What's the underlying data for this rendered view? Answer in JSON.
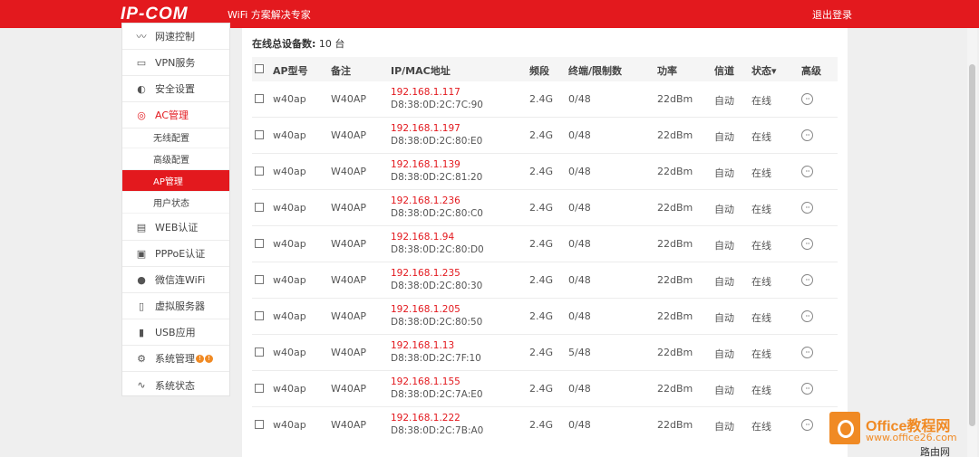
{
  "header": {
    "logo": "IP-COM",
    "slogan": "WiFi 方案解决专家",
    "logout": "退出登录"
  },
  "sidebar": {
    "items": [
      {
        "label": "网速控制",
        "icon": "speed-icon"
      },
      {
        "label": "VPN服务",
        "icon": "vpn-icon"
      },
      {
        "label": "安全设置",
        "icon": "security-icon"
      },
      {
        "label": "AC管理",
        "icon": "ac-icon"
      },
      {
        "label": "WEB认证",
        "icon": "web-auth-icon"
      },
      {
        "label": "PPPoE认证",
        "icon": "pppoe-icon"
      },
      {
        "label": "微信连WiFi",
        "icon": "wechat-icon"
      },
      {
        "label": "虚拟服务器",
        "icon": "server-icon"
      },
      {
        "label": "USB应用",
        "icon": "usb-icon"
      },
      {
        "label": "系统管理",
        "icon": "system-icon"
      },
      {
        "label": "系统状态",
        "icon": "status-icon"
      }
    ],
    "subitems": [
      "无线配置",
      "高级配置",
      "AP管理",
      "用户状态"
    ],
    "badges": [
      "!",
      "!"
    ]
  },
  "summary": {
    "label": "在线总设备数:",
    "count": "10 台"
  },
  "table": {
    "headers": {
      "model": "AP型号",
      "note": "备注",
      "ipmac": "IP/MAC地址",
      "band": "频段",
      "terminals": "终端/限制数",
      "power": "功率",
      "channel": "信道",
      "status": "状态▾",
      "advanced": "高级"
    },
    "rows": [
      {
        "model": "w40ap",
        "note": "W40AP",
        "ip": "192.168.1.117",
        "mac": "D8:38:0D:2C:7C:90",
        "band": "2.4G",
        "terminals": "0/48",
        "power": "22dBm",
        "channel": "自动",
        "status": "在线",
        "more": "···"
      },
      {
        "model": "w40ap",
        "note": "W40AP",
        "ip": "192.168.1.197",
        "mac": "D8:38:0D:2C:80:E0",
        "band": "2.4G",
        "terminals": "0/48",
        "power": "22dBm",
        "channel": "自动",
        "status": "在线",
        "more": "···"
      },
      {
        "model": "w40ap",
        "note": "W40AP",
        "ip": "192.168.1.139",
        "mac": "D8:38:0D:2C:81:20",
        "band": "2.4G",
        "terminals": "0/48",
        "power": "22dBm",
        "channel": "自动",
        "status": "在线",
        "more": "···"
      },
      {
        "model": "w40ap",
        "note": "W40AP",
        "ip": "192.168.1.236",
        "mac": "D8:38:0D:2C:80:C0",
        "band": "2.4G",
        "terminals": "0/48",
        "power": "22dBm",
        "channel": "自动",
        "status": "在线",
        "more": "···"
      },
      {
        "model": "w40ap",
        "note": "W40AP",
        "ip": "192.168.1.94",
        "mac": "D8:38:0D:2C:80:D0",
        "band": "2.4G",
        "terminals": "0/48",
        "power": "22dBm",
        "channel": "自动",
        "status": "在线",
        "more": "···"
      },
      {
        "model": "w40ap",
        "note": "W40AP",
        "ip": "192.168.1.235",
        "mac": "D8:38:0D:2C:80:30",
        "band": "2.4G",
        "terminals": "0/48",
        "power": "22dBm",
        "channel": "自动",
        "status": "在线",
        "more": "···"
      },
      {
        "model": "w40ap",
        "note": "W40AP",
        "ip": "192.168.1.205",
        "mac": "D8:38:0D:2C:80:50",
        "band": "2.4G",
        "terminals": "0/48",
        "power": "22dBm",
        "channel": "自动",
        "status": "在线",
        "more": "···"
      },
      {
        "model": "w40ap",
        "note": "W40AP",
        "ip": "192.168.1.13",
        "mac": "D8:38:0D:2C:7F:10",
        "band": "2.4G",
        "terminals": "5/48",
        "power": "22dBm",
        "channel": "自动",
        "status": "在线",
        "more": "···"
      },
      {
        "model": "w40ap",
        "note": "W40AP",
        "ip": "192.168.1.155",
        "mac": "D8:38:0D:2C:7A:E0",
        "band": "2.4G",
        "terminals": "0/48",
        "power": "22dBm",
        "channel": "自动",
        "status": "在线",
        "more": "···"
      },
      {
        "model": "w40ap",
        "note": "W40AP",
        "ip": "192.168.1.222",
        "mac": "D8:38:0D:2C:7B:A0",
        "band": "2.4G",
        "terminals": "0/48",
        "power": "22dBm",
        "channel": "自动",
        "status": "在线",
        "more": "···"
      }
    ]
  },
  "watermark": {
    "title": "Office教程网",
    "url": "www.office26.com",
    "signature": "路由网"
  },
  "colors": {
    "brand": "#e3191e",
    "ip_text": "#e3191e",
    "watermark": "#f08a24"
  }
}
